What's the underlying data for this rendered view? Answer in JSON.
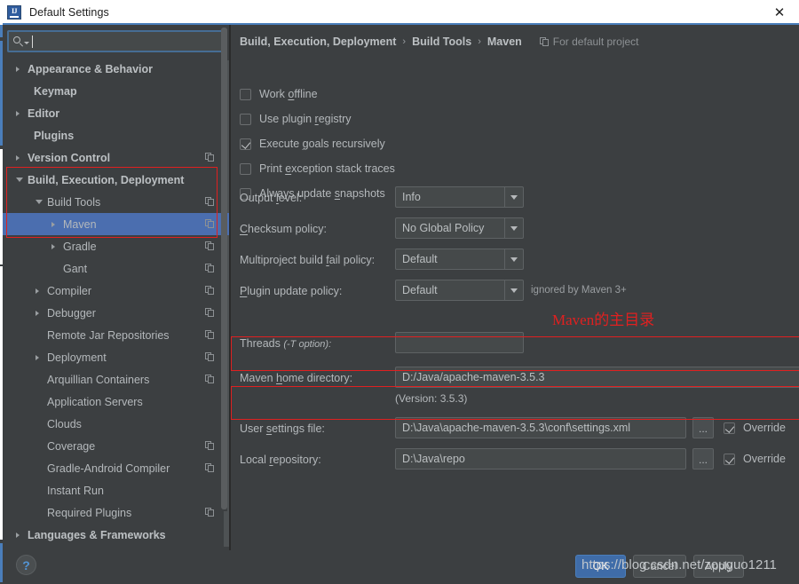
{
  "window": {
    "title": "Default Settings",
    "app_icon": "intellij-idea-icon",
    "close_label": "✕"
  },
  "search": {
    "placeholder": "",
    "value": "",
    "icon": "search-icon",
    "dropdown_icon": "chevron-down-icon"
  },
  "sidebar": {
    "items": [
      {
        "label": "Appearance & Behavior",
        "indent": 28,
        "arrow": "right",
        "bold": true,
        "copy": false,
        "selected": false
      },
      {
        "label": "Keymap",
        "indent": 35,
        "arrow": "none",
        "bold": true,
        "copy": false,
        "selected": false
      },
      {
        "label": "Editor",
        "indent": 28,
        "arrow": "right",
        "bold": true,
        "copy": false,
        "selected": false
      },
      {
        "label": "Plugins",
        "indent": 35,
        "arrow": "none",
        "bold": true,
        "copy": false,
        "selected": false
      },
      {
        "label": "Version Control",
        "indent": 28,
        "arrow": "right",
        "bold": true,
        "copy": true,
        "selected": false
      },
      {
        "label": "Build, Execution, Deployment",
        "indent": 28,
        "arrow": "down",
        "bold": true,
        "copy": false,
        "selected": false
      },
      {
        "label": "Build Tools",
        "indent": 50,
        "arrow": "down",
        "bold": false,
        "copy": true,
        "selected": false
      },
      {
        "label": "Maven",
        "indent": 68,
        "arrow": "right",
        "bold": false,
        "copy": true,
        "selected": true
      },
      {
        "label": "Gradle",
        "indent": 68,
        "arrow": "right",
        "bold": false,
        "copy": true,
        "selected": false
      },
      {
        "label": "Gant",
        "indent": 68,
        "arrow": "none",
        "bold": false,
        "copy": true,
        "selected": false
      },
      {
        "label": "Compiler",
        "indent": 50,
        "arrow": "right",
        "bold": false,
        "copy": true,
        "selected": false
      },
      {
        "label": "Debugger",
        "indent": 50,
        "arrow": "right",
        "bold": false,
        "copy": true,
        "selected": false
      },
      {
        "label": "Remote Jar Repositories",
        "indent": 50,
        "arrow": "none",
        "bold": false,
        "copy": true,
        "selected": false
      },
      {
        "label": "Deployment",
        "indent": 50,
        "arrow": "right",
        "bold": false,
        "copy": true,
        "selected": false
      },
      {
        "label": "Arquillian Containers",
        "indent": 50,
        "arrow": "none",
        "bold": false,
        "copy": true,
        "selected": false
      },
      {
        "label": "Application Servers",
        "indent": 50,
        "arrow": "none",
        "bold": false,
        "copy": false,
        "selected": false
      },
      {
        "label": "Clouds",
        "indent": 50,
        "arrow": "none",
        "bold": false,
        "copy": false,
        "selected": false
      },
      {
        "label": "Coverage",
        "indent": 50,
        "arrow": "none",
        "bold": false,
        "copy": true,
        "selected": false
      },
      {
        "label": "Gradle-Android Compiler",
        "indent": 50,
        "arrow": "none",
        "bold": false,
        "copy": true,
        "selected": false
      },
      {
        "label": "Instant Run",
        "indent": 50,
        "arrow": "none",
        "bold": false,
        "copy": false,
        "selected": false
      },
      {
        "label": "Required Plugins",
        "indent": 50,
        "arrow": "none",
        "bold": false,
        "copy": true,
        "selected": false
      },
      {
        "label": "Languages & Frameworks",
        "indent": 28,
        "arrow": "right",
        "bold": true,
        "copy": false,
        "selected": false
      }
    ]
  },
  "breadcrumb": {
    "items": [
      "Build, Execution, Deployment",
      "Build Tools",
      "Maven"
    ],
    "separator": "›",
    "project_scope": "For default project",
    "project_scope_icon": "copy-icon"
  },
  "checkboxes": [
    {
      "label_pre": "Work ",
      "mnemonic": "o",
      "label_post": "ffline",
      "checked": false
    },
    {
      "label_pre": "Use plugin ",
      "mnemonic": "r",
      "label_post": "egistry",
      "checked": false
    },
    {
      "label_pre": "Execute ",
      "mnemonic": "g",
      "label_post": "oals recursively",
      "checked": true
    },
    {
      "label_pre": "Print ",
      "mnemonic": "e",
      "label_post": "xception stack traces",
      "checked": false
    },
    {
      "label_pre": "Always update ",
      "mnemonic": "s",
      "label_post": "napshots",
      "checked": false
    }
  ],
  "combos": [
    {
      "label_pre": "Output ",
      "mnemonic": "l",
      "label_post": "evel:",
      "value": "Info",
      "hint": ""
    },
    {
      "label_pre": "",
      "mnemonic": "C",
      "label_post": "hecksum policy:",
      "value": "No Global Policy",
      "hint": ""
    },
    {
      "label_pre": "Multiproject build ",
      "mnemonic": "f",
      "label_post": "ail policy:",
      "value": "Default",
      "hint": ""
    },
    {
      "label_pre": "",
      "mnemonic": "P",
      "label_post": "lugin update policy:",
      "value": "Default",
      "hint": "ignored by Maven 3+"
    }
  ],
  "threads": {
    "label": "Threads",
    "label_italic": "(-T option):",
    "value": ""
  },
  "maven_home": {
    "label_pre": "Maven ",
    "mnemonic": "h",
    "label_post": "ome directory:",
    "value": "D:/Java/apache-maven-3.5.3",
    "version_note": "(Version: 3.5.3)",
    "browse_label": "...",
    "dropdown_icon": "chevron-down-icon"
  },
  "user_settings": {
    "label_pre": "User ",
    "mnemonic": "s",
    "label_post": "ettings file:",
    "value": "D:\\Java\\apache-maven-3.5.3\\conf\\settings.xml",
    "browse_label": "...",
    "override_label": "Override",
    "override_checked": true
  },
  "local_repository": {
    "label_pre": "Local ",
    "mnemonic": "r",
    "label_post": "epository:",
    "value": "D:\\Java\\repo",
    "browse_label": "...",
    "override_label": "Override",
    "override_checked": true
  },
  "annotations": {
    "red_text": "Maven的主目录",
    "color": "#e02020"
  },
  "footer": {
    "help_label": "?",
    "buttons": [
      {
        "label": "OK",
        "primary": true
      },
      {
        "label": "Cancel",
        "primary": false
      },
      {
        "label": "Apply",
        "primary": false
      }
    ],
    "watermark": "https://blog.csdn.net/zouguo1211"
  },
  "colors": {
    "background": "#3c3f41",
    "selection": "#4b6eaf",
    "accent": "#4a7ebb",
    "text": "#b4b8bb",
    "annotation_red": "#e02020"
  }
}
